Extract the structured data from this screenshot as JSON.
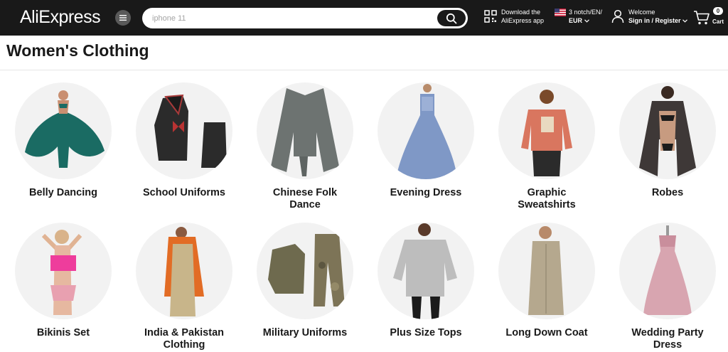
{
  "header": {
    "logo": "AliExpress",
    "search_placeholder": "iphone 11",
    "app_download_line1": "Download the",
    "app_download_line2": "AliExpress app",
    "locale_line1": "3 notch/EN/",
    "locale_line2": "EUR",
    "welcome": "Welcome",
    "signin": "Sign in / Register",
    "cart_count": "0",
    "cart_label": "Cart"
  },
  "page": {
    "title": "Women's Clothing"
  },
  "categories": [
    {
      "label": "Belly Dancing"
    },
    {
      "label": "School Uniforms"
    },
    {
      "label": "Chinese Folk Dance"
    },
    {
      "label": "Evening Dress"
    },
    {
      "label": "Graphic Sweatshirts"
    },
    {
      "label": "Robes"
    },
    {
      "label": "Bikinis Set"
    },
    {
      "label": "India & Pakistan Clothing"
    },
    {
      "label": "Military Uniforms"
    },
    {
      "label": "Plus Size Tops"
    },
    {
      "label": "Long Down Coat"
    },
    {
      "label": "Wedding Party Dress"
    }
  ],
  "icons": {
    "menu": "menu-icon",
    "search": "search-icon",
    "qr": "qr-code-icon",
    "flag": "us-flag-icon",
    "user": "user-icon",
    "cart": "cart-icon"
  },
  "colors": {
    "header_bg": "#191919",
    "circle_bg": "#f2f2f2",
    "text": "#191919"
  }
}
